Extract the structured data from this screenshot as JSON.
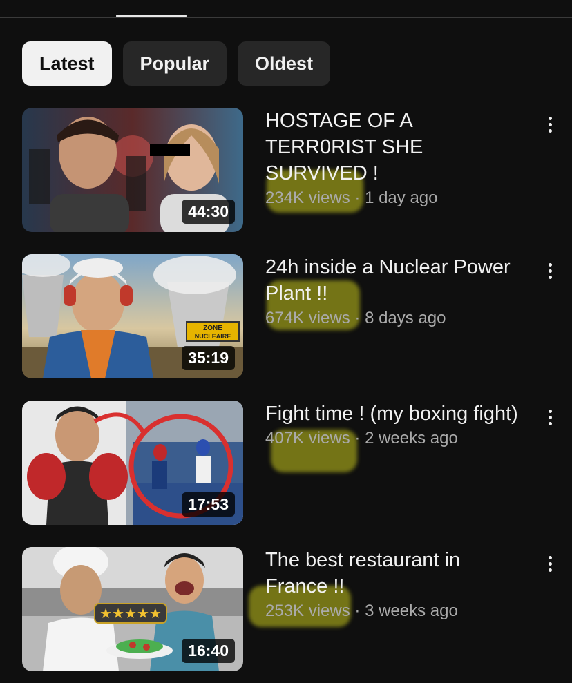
{
  "chips": [
    {
      "label": "Latest",
      "active": true
    },
    {
      "label": "Popular",
      "active": false
    },
    {
      "label": "Oldest",
      "active": false
    }
  ],
  "videos": [
    {
      "title": "HOSTAGE OF A TERR0RIST SHE SURVIVED !",
      "views": "234K views",
      "age": "1 day ago",
      "duration": "44:30"
    },
    {
      "title": "24h inside a Nuclear Power Plant !!",
      "views": "674K views",
      "age": "8 days ago",
      "duration": "35:19",
      "thumb_sign": "ZONE NUCLEAIRE"
    },
    {
      "title": "Fight time ! (my boxing fight)",
      "views": "407K views",
      "age": "2 weeks ago",
      "duration": "17:53"
    },
    {
      "title": "The best restaurant in France !!",
      "views": "253K views",
      "age": "3 weeks ago",
      "duration": "16:40",
      "thumb_badge": "★★★★★"
    }
  ],
  "meta_separator": " · ",
  "colors": {
    "background": "#0f0f0f",
    "chip_active": "#f1f1f1",
    "chip_inactive": "#272727",
    "meta_text": "#aaaaaa",
    "highlight": "#c8c81e"
  }
}
